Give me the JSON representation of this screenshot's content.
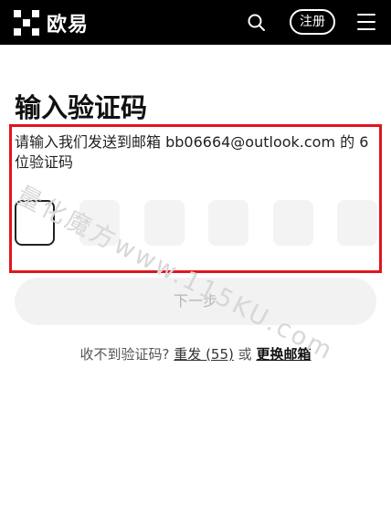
{
  "header": {
    "brand": "欧易",
    "register_label": "注册"
  },
  "page": {
    "title": "输入验证码",
    "description": "请输入我们发送到邮箱 bb06664@outlook.com 的 6 位验证码"
  },
  "code_inputs": [
    "",
    "",
    "",
    "",
    "",
    ""
  ],
  "next_button": "下一步",
  "footer": {
    "no_code": "收不到验证码?",
    "resend": "重发 (55)",
    "or": "或",
    "change_email": "更换邮箱"
  },
  "watermark": "量化魔方www.115KU.com",
  "colors": {
    "highlight": "#e0151d",
    "topbar": "#000000"
  }
}
